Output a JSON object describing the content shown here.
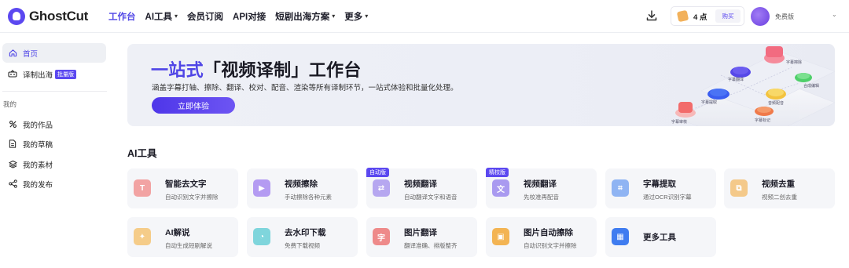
{
  "app": {
    "name": "GhostCut"
  },
  "nav": [
    {
      "label": "工作台",
      "active": true,
      "caret": false
    },
    {
      "label": "AI工具",
      "active": false,
      "caret": true
    },
    {
      "label": "会员订阅",
      "active": false,
      "caret": false
    },
    {
      "label": "API对接",
      "active": false,
      "caret": false
    },
    {
      "label": "短剧出海方案",
      "active": false,
      "caret": true
    },
    {
      "label": "更多",
      "active": false,
      "caret": true
    }
  ],
  "header": {
    "points": "4 点",
    "buy_label": "购买",
    "plan": "免费版"
  },
  "sidebar": {
    "items": [
      {
        "label": "首页",
        "icon": "home-icon",
        "active": true
      },
      {
        "label": "译制出海",
        "icon": "subtitle-translate-icon",
        "badge": "批量版"
      }
    ],
    "group_label": "我的",
    "my_items": [
      {
        "label": "我的作品",
        "icon": "works-icon"
      },
      {
        "label": "我的草稿",
        "icon": "draft-icon"
      },
      {
        "label": "我的素材",
        "icon": "layers-icon"
      },
      {
        "label": "我的发布",
        "icon": "share-icon"
      }
    ]
  },
  "banner": {
    "title_plain": "一站式「视频译制」工作台",
    "title_accent": "一站式",
    "title_rest": "「视频译制」工作台",
    "subtitle": "涵盖字幕打轴、擦除、翻译、校对、配音、渲染等所有译制环节，一站式体验和批量化处理。",
    "cta": "立即体验"
  },
  "tools_section": {
    "title": "AI工具",
    "cards": [
      {
        "title": "智能去文字",
        "desc": "自动识别文字并擦除",
        "icon": "text-remove-icon",
        "color": "#f2a3a3",
        "tag": ""
      },
      {
        "title": "视频擦除",
        "desc": "手动擦除各种元素",
        "icon": "video-erase-icon",
        "color": "#b49bf2",
        "tag": ""
      },
      {
        "title": "视频翻译",
        "desc": "自动翻译文字和语音",
        "icon": "video-translate-icon",
        "color": "#b6a7f0",
        "tag": "自动版"
      },
      {
        "title": "视频翻译",
        "desc": "先校准再配音",
        "icon": "translate-proof-icon",
        "color": "#a99af0",
        "tag": "精校版"
      },
      {
        "title": "字幕提取",
        "desc": "通过OCR识别字幕",
        "icon": "subtitle-extract-icon",
        "color": "#8fb4f3",
        "tag": ""
      },
      {
        "title": "视频去重",
        "desc": "视频二创去重",
        "icon": "dedupe-icon",
        "color": "#f4c98a",
        "tag": ""
      },
      {
        "title": "AI解说",
        "desc": "自动生成短剧解说",
        "icon": "ai-narration-icon",
        "color": "#f5cc89",
        "tag": ""
      },
      {
        "title": "去水印下载",
        "desc": "免费下载视频",
        "icon": "watermark-download-icon",
        "color": "#7fd5dc",
        "tag": ""
      },
      {
        "title": "图片翻译",
        "desc": "翻译准确、排版整齐",
        "icon": "image-translate-icon",
        "color": "#ee8a8a",
        "tag": ""
      },
      {
        "title": "图片自动擦除",
        "desc": "自动识别文字并擦除",
        "icon": "image-erase-icon",
        "color": "#f3b453",
        "tag": ""
      },
      {
        "title": "更多工具",
        "desc": "",
        "icon": "more-tools-icon",
        "color": "#3f7cf0",
        "tag": ""
      }
    ]
  },
  "banner_art_labels": [
    "字幕擦除",
    "合成编辑",
    "字幕翻译",
    "字幕提取",
    "音频配音",
    "字幕审核",
    "字幕标记"
  ]
}
